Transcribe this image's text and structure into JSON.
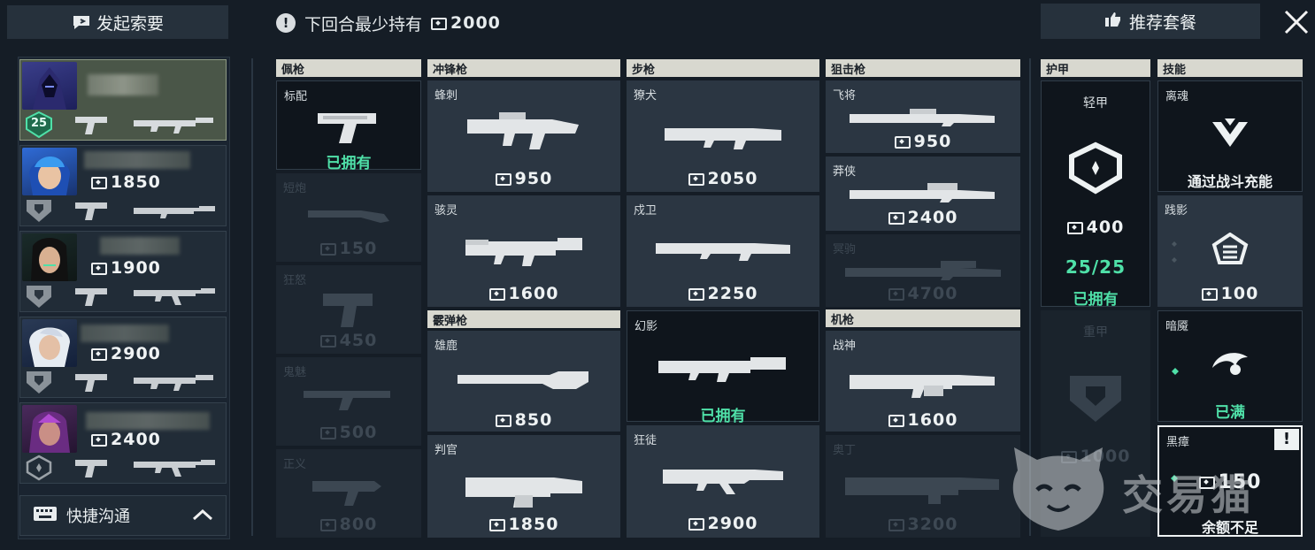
{
  "top": {
    "request_label": "发起索要",
    "min_notice": "下回合最少持有",
    "min_amount": "2000",
    "recommend_label": "推荐套餐"
  },
  "team": {
    "players": [
      {
        "money": "",
        "level": "25"
      },
      {
        "money": "1850"
      },
      {
        "money": "1900"
      },
      {
        "money": "2900"
      },
      {
        "money": "2400"
      }
    ],
    "quick_comm_label": "快捷沟通"
  },
  "shop": {
    "sidearms": {
      "header": "佩枪",
      "items": [
        {
          "name": "标配",
          "status": "已拥有"
        },
        {
          "name": "短炮",
          "price": "150"
        },
        {
          "name": "狂怒",
          "price": "450"
        },
        {
          "name": "鬼魅",
          "price": "500"
        },
        {
          "name": "正义",
          "price": "800"
        }
      ]
    },
    "smg": {
      "header": "冲锋枪",
      "items": [
        {
          "name": "蜂刺",
          "price": "950"
        },
        {
          "name": "骇灵",
          "price": "1600"
        }
      ]
    },
    "shotgun": {
      "header": "霰弹枪",
      "items": [
        {
          "name": "雄鹿",
          "price": "850"
        },
        {
          "name": "判官",
          "price": "1850"
        }
      ]
    },
    "rifles": {
      "header": "步枪",
      "items": [
        {
          "name": "獠犬",
          "price": "2050"
        },
        {
          "name": "戍卫",
          "price": "2250"
        },
        {
          "name": "幻影",
          "status": "已拥有"
        },
        {
          "name": "狂徒",
          "price": "2900"
        }
      ]
    },
    "snipers": {
      "header": "狙击枪",
      "items": [
        {
          "name": "飞将",
          "price": "950"
        },
        {
          "name": "莽侠",
          "price": "2400"
        },
        {
          "name": "冥驹",
          "price": "4700"
        }
      ]
    },
    "heavy": {
      "header": "机枪",
      "items": [
        {
          "name": "战神",
          "price": "1600"
        },
        {
          "name": "奥丁",
          "price": "3200"
        }
      ]
    },
    "armor": {
      "header": "护甲",
      "items": [
        {
          "name": "轻甲",
          "price": "400",
          "count": "25/25",
          "status": "已拥有"
        },
        {
          "name": "重甲",
          "price": "1000"
        }
      ]
    },
    "abilities": {
      "header": "技能",
      "items": [
        {
          "name": "离魂",
          "status": "通过战斗充能"
        },
        {
          "name": "践影",
          "price": "100"
        },
        {
          "name": "暗魇",
          "status": "已满"
        },
        {
          "name": "黑瘴",
          "price": "150",
          "status": "余额不足"
        }
      ]
    }
  },
  "watermark": "交易猫"
}
